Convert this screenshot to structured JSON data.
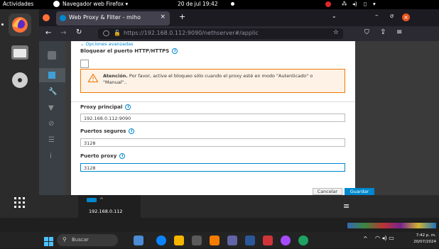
{
  "topbar": {
    "activities": "Actividades",
    "app_name": "Navegador web Firefox ▾",
    "clock": "20 de jul 19:42"
  },
  "firefox": {
    "tab_title": "Web Proxy & Filter - miho",
    "url_host": "https://192.168.0.112",
    "url_rest": ":9090/nethserver#/applic"
  },
  "nethserver": {
    "breadcrumb": "Opciones avanzadas",
    "block_label": "Bloquear el puerto HTTP/HTTPS",
    "warning_title": "Atención.",
    "warning_text": "Por favor, active el bloqueo sólo cuando el proxy esté en modo \"Autenticado\" o \"Manual\"..",
    "proxy_principal_label": "Proxy principal",
    "proxy_principal_value": "192.168.0.112:9090",
    "puertos_seguros_label": "Puertos seguros",
    "puertos_seguros_value": "3128",
    "puerto_proxy_label": "Puerto proxy",
    "puerto_proxy_value": "3128",
    "cancel_label": "Cancelar",
    "save_label": "Guardar",
    "host_label": "192.168.0.112"
  },
  "taskbar": {
    "search_placeholder": "Buscar",
    "time": "7:42 p. m.",
    "date": "20/07/2024"
  },
  "colors": {
    "primary": "#0088ce",
    "warning_border": "#ec7a08",
    "warning_bg": "#fdf2e5"
  }
}
